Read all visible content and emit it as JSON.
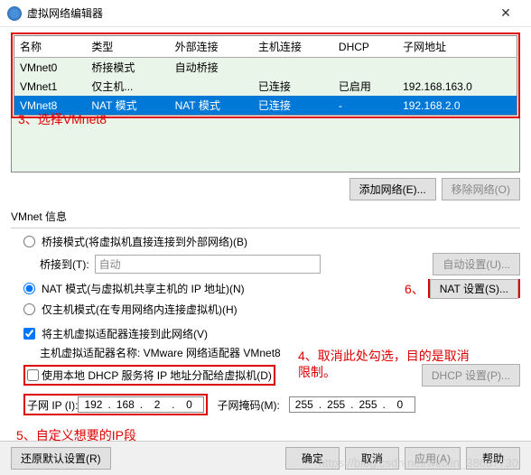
{
  "window": {
    "title": "虚拟网络编辑器",
    "close": "✕"
  },
  "table": {
    "headers": [
      "名称",
      "类型",
      "外部连接",
      "主机连接",
      "DHCP",
      "子网地址"
    ],
    "rows": [
      {
        "name": "VMnet0",
        "type": "桥接模式",
        "ext": "自动桥接",
        "host": "",
        "dhcp": "",
        "subnet": ""
      },
      {
        "name": "VMnet1",
        "type": "仅主机...",
        "ext": "",
        "host": "已连接",
        "dhcp": "已启用",
        "subnet": "192.168.163.0"
      },
      {
        "name": "VMnet8",
        "type": "NAT 模式",
        "ext": "NAT 模式",
        "host": "已连接",
        "dhcp": "-",
        "subnet": "192.168.2.0"
      }
    ]
  },
  "annot": {
    "a3": "3、选择VMnet8",
    "a4": "4、取消此处勾选，目的是取消限制。",
    "a5": "5、自定义想要的IP段",
    "a6": "6、"
  },
  "buttons": {
    "addNet": "添加网络(E)...",
    "removeNet": "移除网络(O)",
    "autoSet": "自动设置(U)...",
    "natSet": "NAT 设置(S)...",
    "dhcpSet": "DHCP 设置(P)...",
    "restore": "还原默认设置(R)",
    "ok": "确定",
    "cancel": "取消",
    "apply": "应用(A)",
    "help": "帮助"
  },
  "info": {
    "section": "VMnet 信息",
    "bridged": "桥接模式(将虚拟机直接连接到外部网络)(B)",
    "bridgeTo": "桥接到(T):",
    "bridgeAuto": "自动",
    "nat": "NAT 模式(与虚拟机共享主机的 IP 地址)(N)",
    "hostonly": "仅主机模式(在专用网络内连接虚拟机)(H)",
    "hostConn": "将主机虚拟适配器连接到此网络(V)",
    "adapterLabel": "主机虚拟适配器名称: VMware 网络适配器 VMnet8",
    "dhcp": "使用本地 DHCP 服务将 IP 地址分配给虚拟机(D)",
    "subnetIP": "子网 IP (I):",
    "subnetMask": "子网掩码(M):",
    "ip": [
      "192",
      "168",
      "2",
      "0"
    ],
    "mask": [
      "255",
      "255",
      "255",
      "0"
    ]
  },
  "watermark": "https://blog.csdn.net/weixin_38637730"
}
